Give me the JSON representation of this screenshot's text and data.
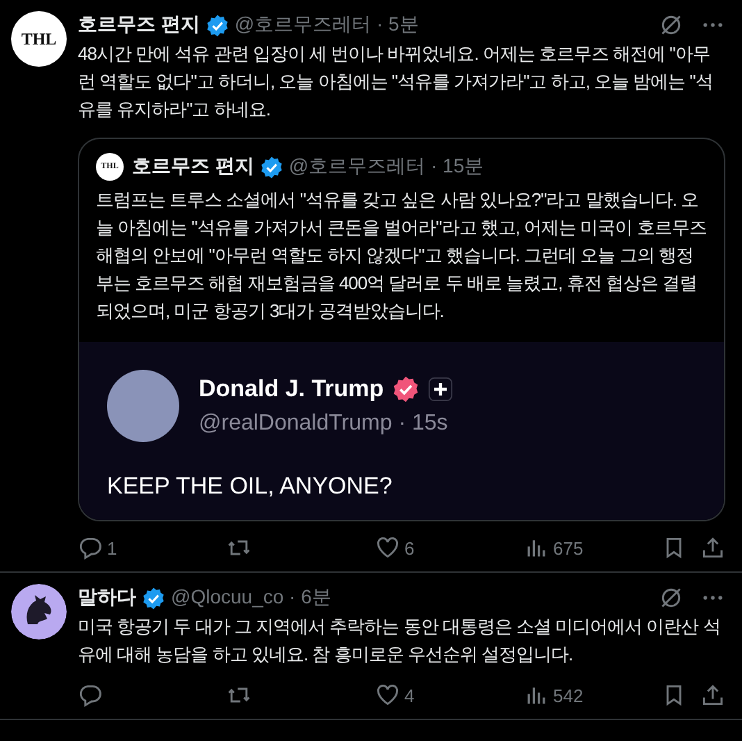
{
  "posts": [
    {
      "avatar": {
        "kind": "logo",
        "text": "THL"
      },
      "name": "호르무즈 편지",
      "verified": true,
      "meta": "@호르무즈레터 · 5분",
      "text": "48시간 만에 석유 관련 입장이 세 번이나 바뀌었네요. 어제는 호르무즈 해전에 \"아무런 역할도 없다\"고 하더니, 오늘 아침에는 \"석유를 가져가라\"고 하고, 오늘 밤에는 \"석유를 유지하라\"고 하네요.",
      "quote": {
        "avatar": {
          "kind": "logo",
          "text": "THL"
        },
        "name": "호르무즈 편지",
        "verified": true,
        "meta": "@호르무즈레터 · 15분",
        "text": "트럼프는 트루스 소셜에서 \"석유를 갖고 싶은 사람 있나요?\"라고 말했습니다. 오늘 아침에는 \"석유를 가져가서 큰돈을 벌어라\"라고 했고, 어제는 미국이 호르무즈 해협의 안보에 \"아무런 역할도 하지 않겠다\"고 했습니다. 그런데 오늘 그의 행정부는 호르무즈 해협 재보험금을 400억 달러로 두 배로 늘렸고, 휴전 협상은 결렬되었으며, 미군 항공기 3대가 공격받았습니다.",
        "embed": {
          "name": "Donald J. Trump",
          "meta": "@realDonaldTrump · 15s",
          "text": "KEEP THE OIL, ANYONE?"
        }
      },
      "actions": [
        {
          "kind": "reply",
          "count": "1"
        },
        {
          "kind": "repost"
        },
        {
          "kind": "like",
          "count": "6"
        },
        {
          "kind": "views",
          "count": "675"
        },
        {
          "kind": "bookmark"
        },
        {
          "kind": "share"
        }
      ]
    },
    {
      "avatar": {
        "kind": "icon"
      },
      "name": "말하다",
      "verified": true,
      "meta": "@Qlocuu_co · 6분",
      "text": "미국 항공기 두 대가 그 지역에서 추락하는 동안 대통령은 소셜 미디어에서 이란산 석유에 대해 농담을 하고 있네요. 참 흥미로운 우선순위 설정입니다.",
      "actions": [
        {
          "kind": "reply"
        },
        {
          "kind": "repost"
        },
        {
          "kind": "like",
          "count": "4"
        },
        {
          "kind": "views",
          "count": "542"
        },
        {
          "kind": "bookmark"
        },
        {
          "kind": "share"
        }
      ]
    }
  ]
}
